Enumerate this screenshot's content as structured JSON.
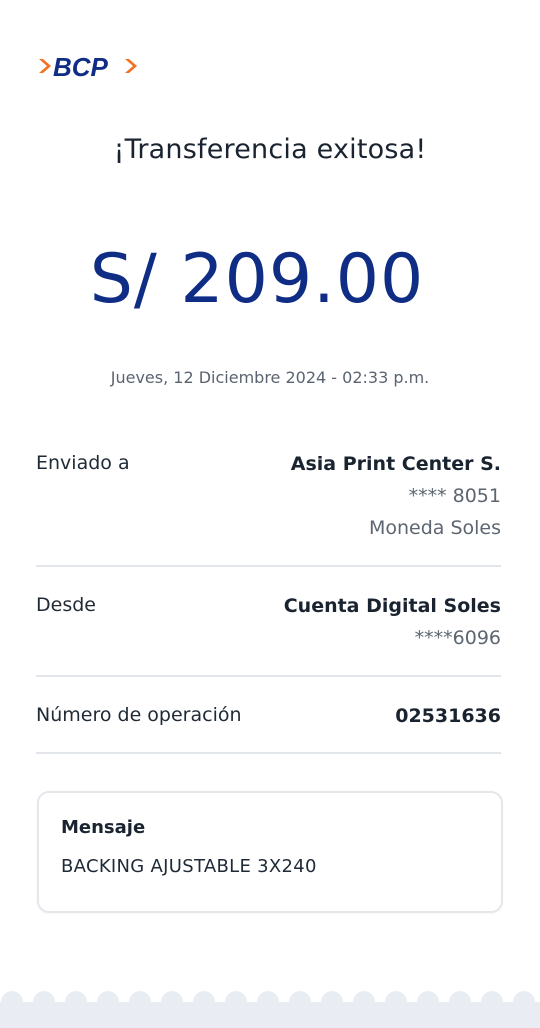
{
  "brand": {
    "name": "BCP",
    "logo_text": "BCP",
    "primary_color": "#0f2d85",
    "accent_color": "#f37021",
    "icon": "bcp-logo-icon"
  },
  "receipt": {
    "title": "¡Transferencia exitosa!",
    "amount": "S/ 209.00",
    "datetime": "Jueves, 12 Diciembre 2024 - 02:33 p.m."
  },
  "sent_to": {
    "label": "Enviado a",
    "name": "Asia Print Center S.",
    "account": "**** 8051",
    "currency": "Moneda Soles"
  },
  "from": {
    "label": "Desde",
    "account_name": "Cuenta Digital Soles",
    "account_number": "****6096"
  },
  "operation": {
    "label": "Número de operación",
    "number": "02531636"
  },
  "message": {
    "title": "Mensaje",
    "text": "BACKING AJUSTABLE 3X240"
  },
  "colors": {
    "divider": "#e2e5e9",
    "scallop": "#e9edf3"
  }
}
